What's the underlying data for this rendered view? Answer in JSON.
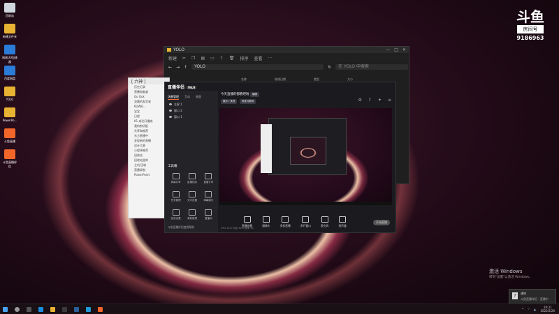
{
  "desktop": {
    "icons": [
      {
        "label": "回收站",
        "kind": "bin"
      },
      {
        "label": "新建文件夹",
        "kind": "folder"
      },
      {
        "label": "网易UU加速器",
        "kind": "app-blue"
      },
      {
        "label": "百度网盘",
        "kind": "app-blue"
      },
      {
        "label": "YOLO",
        "kind": "folder"
      },
      {
        "label": "PowerPo...",
        "kind": "folder"
      },
      {
        "label": "斗鱼直播",
        "kind": "app-orange"
      },
      {
        "label": "斗鱼直播伴侣",
        "kind": "app-orange"
      }
    ]
  },
  "watermark": {
    "logo": "斗鱼",
    "room_label": "房间号",
    "room_number": "9186963"
  },
  "explorer": {
    "title": "YOLO",
    "toolbar": [
      "新建",
      "排序",
      "查看"
    ],
    "address": "YOLO",
    "search_placeholder": "在 YOLO 中搜索",
    "columns": [
      "名称",
      "修改日期",
      "类型",
      "大小"
    ]
  },
  "chat": {
    "title": "[ 六神 ]",
    "rows": [
      "历史记录",
      "直播电脑桌",
      "Go Ouk",
      "凌晨的发货来",
      "KUWEI…",
      "宝宝",
      "日程",
      "K1 成功开播成",
      "我的剪切板",
      "共享和推荐",
      "东方直播中",
      "发现新的直播",
      "设计大赛",
      "小程序推荐",
      "回收站",
      "回收站里的",
      "主机 回收",
      "直播录制",
      "PowerPoint"
    ]
  },
  "live": {
    "brand": "直播伴侣",
    "brand_tag": "V6.0",
    "tabs": [
      "场景管理",
      "互动",
      "画面"
    ],
    "scenes": [
      "主屏 1",
      "窗口 2",
      "窗口 1"
    ],
    "stream_title": "今天直播的都看吧啦",
    "title_badge": "编辑",
    "pills": [
      "娱乐 / 其他",
      "科技与数码"
    ],
    "tools_title": "工具箱",
    "tools": [
      "屏幕共享",
      "直播贴纸",
      "直播计时",
      "任务管理",
      "文字设置",
      "弹幕娱乐",
      "回放设置",
      "录制管理",
      "直播间"
    ],
    "bottom_left": "斗鱼直播伴侣使用帮助",
    "actions": [
      "直播场景",
      "摄像头",
      "多机直播",
      "多开窗口",
      "麦克风",
      "扬声器"
    ],
    "start_label": "开始直播",
    "status": "CPU 12%  内存 32%  帧率 30"
  },
  "activation": {
    "title": "激活 Windows",
    "sub": "转到\"设置\"以激活 Windows。"
  },
  "toast": {
    "title": "通知",
    "body": "斗鱼直播伴侣 · 直播中"
  },
  "clock": {
    "time": "20:31",
    "date": "2022/2/26"
  },
  "colors": {
    "accent": "#ff6a3c",
    "folder": "#e8b233",
    "douyu_orange": "#f2662a"
  }
}
